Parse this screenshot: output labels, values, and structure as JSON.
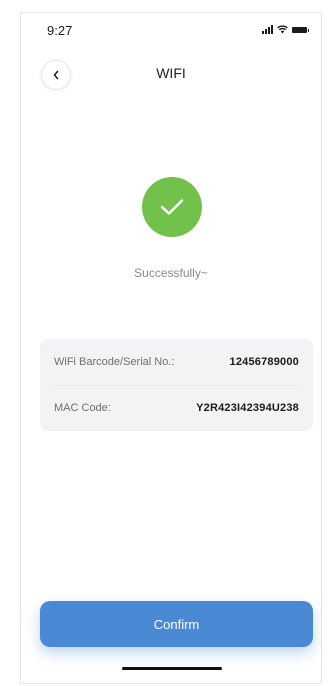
{
  "status_bar": {
    "time": "9:27",
    "icons": [
      "cellular-signal-icon",
      "wifi-icon",
      "battery-icon"
    ]
  },
  "header": {
    "title": "WIFI",
    "back_icon": "chevron-left-icon"
  },
  "result": {
    "icon": "checkmark-icon",
    "message": "Successfully~"
  },
  "info": {
    "rows": [
      {
        "label": "WiFi Barcode/Serial No.:",
        "value": "12456789000"
      },
      {
        "label": "MAC Code:",
        "value": "Y2R423I42394U238"
      }
    ]
  },
  "confirm": {
    "label": "Confirm"
  },
  "colors": {
    "success": "#72c14a",
    "primary": "#4a8ad5",
    "card_background": "#f3f3f5"
  }
}
